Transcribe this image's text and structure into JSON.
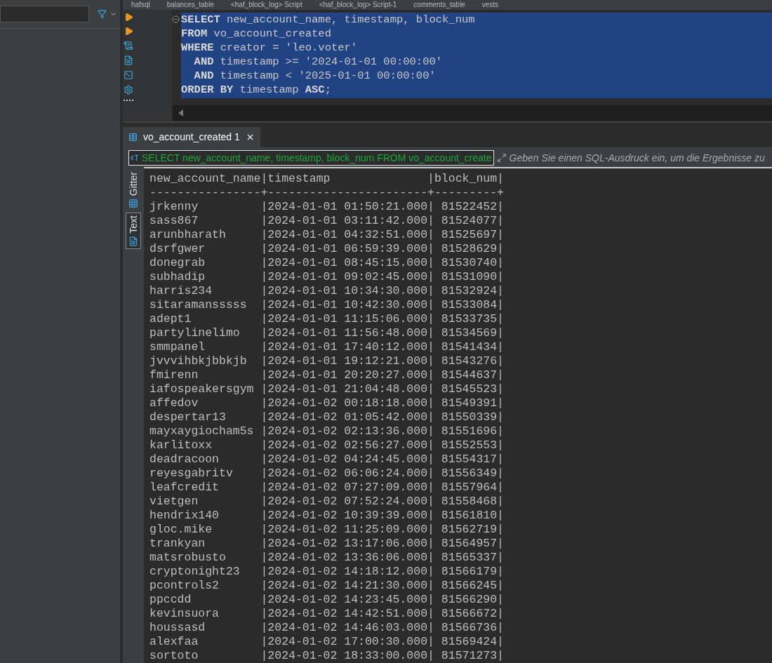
{
  "editor_tabs": [
    {
      "label": "hafsql",
      "selected": false
    },
    {
      "label": "balances_table",
      "selected": false
    },
    {
      "label": "<haf_block_log> Script",
      "selected": false
    },
    {
      "label": "<haf_block_log> Script-1",
      "selected": false
    },
    {
      "label": "comments_table",
      "selected": false
    },
    {
      "label": "vests",
      "selected": false
    }
  ],
  "sql_lines": [
    "**SELECT** new_account_name, timestamp, block_num",
    "**FROM** vo_account_created",
    "**WHERE** creator = 'leo.voter'",
    "  **AND** timestamp >= '2024-01-01 00:00:00'",
    "  **AND** timestamp < '2025-01-01 00:00:00'",
    "**ORDER BY** timestamp **ASC**;"
  ],
  "result_tab": {
    "label": "vo_account_created 1",
    "selected": true
  },
  "filter": {
    "query": "SELECT new_account_name, timestamp, block_num FROM vo_account_create",
    "placeholder": "Geben Sie einen SQL-Ausdruck ein, um die Ergebnisse zu"
  },
  "view_tabs": [
    {
      "label": "Gitter",
      "selected": false
    },
    {
      "label": "Text",
      "selected": true
    }
  ],
  "text_output": [
    "new_account_name|timestamp              |block_num|",
    "----------------+-----------------------+---------+",
    "jrkenny         |2024-01-01 01:50:21.000| 81522452|",
    "sass867         |2024-01-01 03:11:42.000| 81524077|",
    "arunbharath     |2024-01-01 04:32:51.000| 81525697|",
    "dsrfgwer        |2024-01-01 06:59:39.000| 81528629|",
    "donegrab        |2024-01-01 08:45:15.000| 81530740|",
    "subhadip        |2024-01-01 09:02:45.000| 81531090|",
    "harris234       |2024-01-01 10:34:30.000| 81532924|",
    "sitaramansssss  |2024-01-01 10:42:30.000| 81533084|",
    "adept1          |2024-01-01 11:15:06.000| 81533735|",
    "partylinelimo   |2024-01-01 11:56:48.000| 81534569|",
    "smmpanel        |2024-01-01 17:40:12.000| 81541434|",
    "jvvvihbkjbbkjb  |2024-01-01 19:12:21.000| 81543276|",
    "fmirenn         |2024-01-01 20:20:27.000| 81544637|",
    "iafospeakersgym |2024-01-01 21:04:48.000| 81545523|",
    "affedov         |2024-01-02 00:18:18.000| 81549391|",
    "despertar13     |2024-01-02 01:05:42.000| 81550339|",
    "mayxaygiocham5s |2024-01-02 02:13:36.000| 81551696|",
    "karlitoxx       |2024-01-02 02:56:27.000| 81552553|",
    "deadracoon      |2024-01-02 04:24:45.000| 81554317|",
    "reyesgabritv    |2024-01-02 06:06:24.000| 81556349|",
    "leafcredit      |2024-01-02 07:27:09.000| 81557964|",
    "vietgen         |2024-01-02 07:52:24.000| 81558468|",
    "hendrix140      |2024-01-02 10:39:39.000| 81561810|",
    "gloc.mike       |2024-01-02 11:25:09.000| 81562719|",
    "trankyan        |2024-01-02 13:17:06.000| 81564957|",
    "matsrobusto     |2024-01-02 13:36:06.000| 81565337|",
    "cryptonight23   |2024-01-02 14:18:12.000| 81566179|",
    "pcontrols2      |2024-01-02 14:21:30.000| 81566245|",
    "ppccdd          |2024-01-02 14:23:45.000| 81566290|",
    "kevinsuora      |2024-01-02 14:42:51.000| 81566672|",
    "houssasd        |2024-01-02 14:46:03.000| 81566736|",
    "alexfaa         |2024-01-02 17:00:30.000| 81569424|",
    "sortoto         |2024-01-02 18:33:00.000| 81571273|"
  ]
}
